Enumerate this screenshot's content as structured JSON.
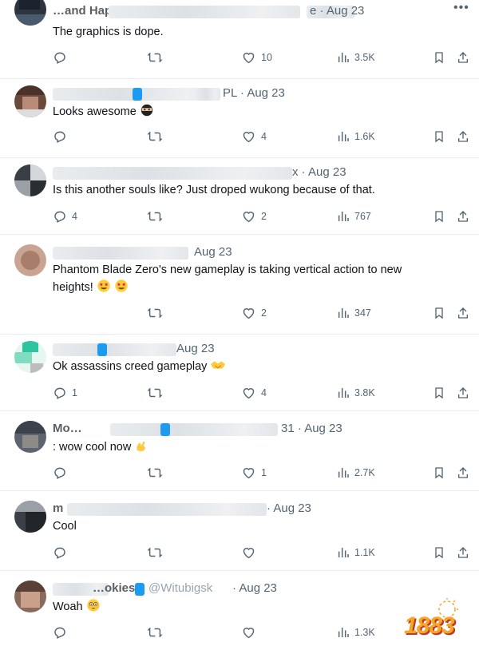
{
  "posts": [
    {
      "name_hint": "…and Happ",
      "handle_hint": "e",
      "date": "Aug 23",
      "text": "The graphics is dope.",
      "emoji": "",
      "replies": "",
      "reposts": "",
      "likes": "10",
      "views": "3.5K"
    },
    {
      "name_hint": "",
      "handle_hint": "PL",
      "date": "Aug 23",
      "text": "Looks awesome",
      "emoji": "ninja",
      "replies": "",
      "reposts": "",
      "likes": "4",
      "views": "1.6K"
    },
    {
      "name_hint": "",
      "handle_hint": "x",
      "date": "Aug 23",
      "text": "Is this another souls like? Just droped wukong because of that.",
      "emoji": "",
      "replies": "4",
      "reposts": "",
      "likes": "2",
      "views": "767"
    },
    {
      "name_hint": "",
      "handle_hint": "",
      "date": "Aug 23",
      "text": "Phantom Blade Zero's new gameplay is taking vertical action to new heights!",
      "emoji": "star-struck-x2",
      "replies": "",
      "reposts": "",
      "likes": "2",
      "views": "347"
    },
    {
      "name_hint": "",
      "handle_hint": "",
      "date": "Aug 23",
      "text": "Ok assassins creed gameplay",
      "emoji": "handshake",
      "replies": "1",
      "reposts": "",
      "likes": "4",
      "views": "3.8K"
    },
    {
      "name_hint": "Mo…",
      "handle_hint": "31",
      "date": "Aug 23",
      "text": ": wow cool now",
      "emoji": "pinching-hand",
      "replies": "",
      "reposts": "",
      "likes": "1",
      "views": "2.7K"
    },
    {
      "name_hint": "m",
      "handle_hint": "",
      "date": "Aug 23",
      "text": "Cool",
      "emoji": "",
      "replies": "",
      "reposts": "",
      "likes": "",
      "views": "1.1K"
    },
    {
      "name_hint": "…okies",
      "handle_hint": "@Witubigsk",
      "date": "Aug 23",
      "text": "Woah",
      "emoji": "flushed",
      "replies": "",
      "reposts": "",
      "likes": "",
      "views": "1.3K"
    }
  ],
  "watermark": {
    "text": "1883"
  },
  "colors": {
    "text": "#0f1419",
    "muted": "#536471",
    "divider": "#e6ecf0",
    "verified": "#1d9bf0"
  }
}
